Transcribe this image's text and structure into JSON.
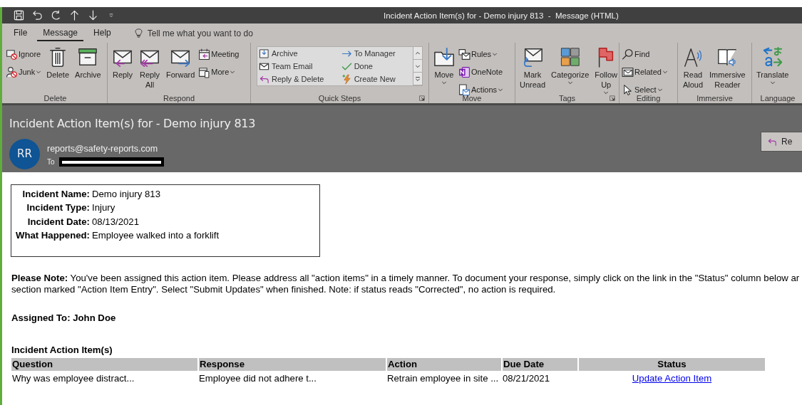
{
  "window": {
    "title": "Incident Action Item(s) for - Demo injury 813  -  Message (HTML)"
  },
  "ribbon_tabs": [
    {
      "label": "File",
      "selected": false
    },
    {
      "label": "Message",
      "selected": true
    },
    {
      "label": "Help",
      "selected": false
    }
  ],
  "tell_me": {
    "placeholder": "Tell me what you want to do"
  },
  "ribbon_groups": [
    {
      "label": "Delete",
      "launcher": false,
      "items": [
        {
          "kind": "small",
          "label": "Ignore",
          "dropdown": false
        },
        {
          "kind": "small",
          "label": "Junk",
          "dropdown": true
        },
        {
          "kind": "large",
          "label": "Delete",
          "dropdown": false
        },
        {
          "kind": "large",
          "label": "Archive",
          "dropdown": false
        }
      ]
    },
    {
      "label": "Respond",
      "launcher": false,
      "items": [
        {
          "kind": "large",
          "label": "Reply",
          "dropdown": false
        },
        {
          "kind": "large",
          "label": "Reply\nAll",
          "dropdown": false
        },
        {
          "kind": "large",
          "label": "Forward",
          "dropdown": false
        },
        {
          "kind": "small",
          "label": "Meeting",
          "dropdown": false
        },
        {
          "kind": "small",
          "label": "More",
          "dropdown": true
        }
      ]
    },
    {
      "label": "Quick Steps",
      "launcher": true,
      "items": [
        {
          "kind": "gallery",
          "entries": [
            "Archive",
            "Team Email",
            "Reply & Delete",
            "To Manager",
            "Done",
            "Create New"
          ]
        }
      ]
    },
    {
      "label": "Move",
      "launcher": false,
      "items": [
        {
          "kind": "large",
          "label": "Move",
          "dropdown": true
        },
        {
          "kind": "small",
          "label": "Rules",
          "dropdown": true
        },
        {
          "kind": "small",
          "label": "OneNote",
          "dropdown": false
        },
        {
          "kind": "small",
          "label": "Actions",
          "dropdown": true
        }
      ]
    },
    {
      "label": "Tags",
      "launcher": true,
      "items": [
        {
          "kind": "large",
          "label": "Mark\nUnread",
          "dropdown": false
        },
        {
          "kind": "large",
          "label": "Categorize",
          "dropdown": true
        },
        {
          "kind": "large",
          "label": "Follow\nUp",
          "dropdown": true
        }
      ]
    },
    {
      "label": "Editing",
      "launcher": false,
      "items": [
        {
          "kind": "small",
          "label": "Find",
          "dropdown": false
        },
        {
          "kind": "small",
          "label": "Related",
          "dropdown": true
        },
        {
          "kind": "small",
          "label": "Select",
          "dropdown": true
        }
      ]
    },
    {
      "label": "Immersive",
      "launcher": false,
      "items": [
        {
          "kind": "large",
          "label": "Read\nAloud",
          "dropdown": false
        },
        {
          "kind": "large",
          "label": "Immersive\nReader",
          "dropdown": false
        }
      ]
    },
    {
      "label": "Language",
      "launcher": false,
      "items": [
        {
          "kind": "large",
          "label": "Translate",
          "dropdown": true
        }
      ]
    }
  ],
  "message": {
    "subject": "Incident Action Item(s) for - Demo injury 813",
    "avatar": "RR",
    "sender": "reports@safety-reports.com",
    "to_label": "To",
    "reply_button": "Re"
  },
  "details": [
    {
      "label": "Incident Name:",
      "value": "Demo injury 813"
    },
    {
      "label": "Incident Type:",
      "value": "Injury"
    },
    {
      "label": "Incident Date:",
      "value": "08/13/2021"
    },
    {
      "label": "What Happened:",
      "value": "Employee walked into a forklift"
    }
  ],
  "note": [
    "**Please Note:**  You've been assigned this action item. Please address all \"action items\" in a timely manner. To document your response, simply click on the link in the \"Status\" column below ar",
    "section marked \"Action Item Entry\". Select \"Submit Updates\" when finished. Note: if status reads \"Corrected\", no action is required."
  ],
  "assigned": "Assigned To:  John Doe",
  "table": {
    "title": "Incident Action Item(s)",
    "columns": [
      "Question",
      "Response",
      "Action",
      "Due Date",
      "Status"
    ],
    "rows": [
      [
        "Why was employee distract...",
        "Employee did not adhere t...",
        "Retrain employee in site ...",
        "08/21/2021",
        "Update Action Item"
      ]
    ]
  }
}
